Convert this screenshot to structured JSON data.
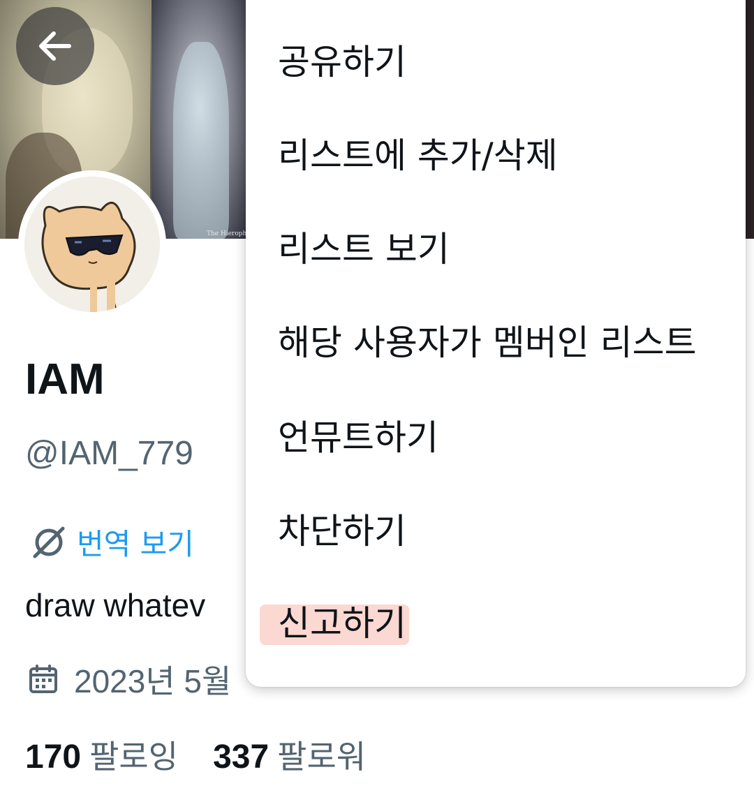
{
  "profile": {
    "display_name": "IAM",
    "handle": "@IAM_779",
    "translate_label": "번역 보기",
    "bio": "draw whatev",
    "joined": "2023년 5월",
    "following_count": "170",
    "following_label": "팔로잉",
    "followers_count": "337",
    "followers_label": "팔로워"
  },
  "banner": {
    "caption": "The Hieropha"
  },
  "menu": {
    "items": [
      {
        "label": "공유하기"
      },
      {
        "label": "리스트에 추가/삭제"
      },
      {
        "label": "리스트 보기"
      },
      {
        "label": "해당 사용자가 멤버인 리스트"
      },
      {
        "label": "언뮤트하기"
      },
      {
        "label": "차단하기"
      },
      {
        "label": "신고하기",
        "highlighted": true
      }
    ]
  },
  "colors": {
    "accent": "#1d9bf0",
    "secondary_text": "#536471",
    "highlight": "#fbd8d1"
  },
  "icons": {
    "back": "arrow-left-icon",
    "translate": "globe-slash-icon",
    "calendar": "calendar-icon"
  }
}
